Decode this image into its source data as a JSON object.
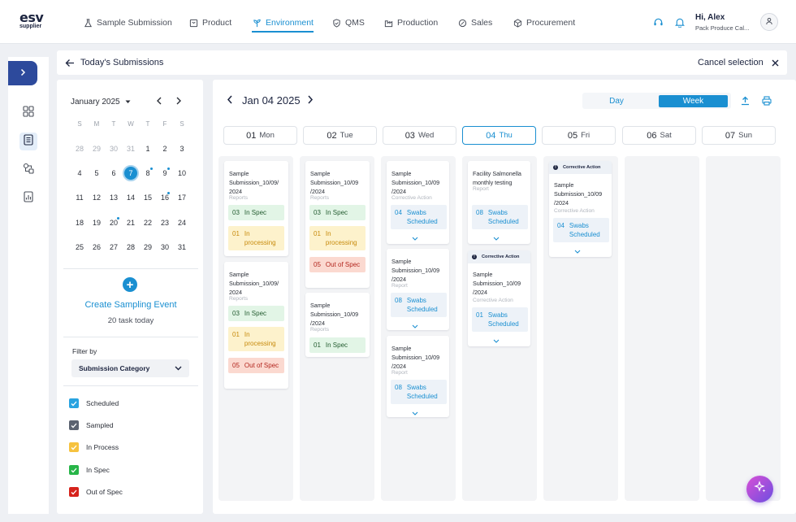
{
  "brand": {
    "logo_top": "esv",
    "logo_bottom": "supplier"
  },
  "nav": {
    "items": [
      {
        "label": "Sample Submission",
        "icon": "flask-icon"
      },
      {
        "label": "Product",
        "icon": "box-icon"
      },
      {
        "label": "Environment",
        "icon": "plant-icon",
        "active": true
      },
      {
        "label": "QMS",
        "icon": "shield-check-icon"
      },
      {
        "label": "Production",
        "icon": "factory-icon"
      },
      {
        "label": "Sales",
        "icon": "tag-icon"
      },
      {
        "label": "Procurement",
        "icon": "cube-icon"
      }
    ]
  },
  "user": {
    "greeting": "Hi, Alex",
    "org": "Pack Produce Cal..."
  },
  "title_bar": {
    "title": "Today's Submissions",
    "cancel_label": "Cancel selection"
  },
  "mini_calendar": {
    "month_label": "January 2025",
    "weekdays": [
      "S",
      "M",
      "T",
      "W",
      "T",
      "F",
      "S"
    ],
    "weeks": [
      [
        "28",
        "29",
        "30",
        "31",
        "1",
        "2",
        "3"
      ],
      [
        "4",
        "5",
        "6",
        "7",
        "8",
        "9",
        "10"
      ],
      [
        "11",
        "12",
        "13",
        "14",
        "15",
        "16",
        "17"
      ],
      [
        "18",
        "19",
        "20",
        "21",
        "22",
        "23",
        "24"
      ],
      [
        "25",
        "26",
        "27",
        "28",
        "29",
        "30",
        "31"
      ]
    ],
    "selected_day": "7"
  },
  "create_event": {
    "label": "Create Sampling Event",
    "tasks_today": "20 task today"
  },
  "filter": {
    "label": "Filter by",
    "selected": "Submission Category"
  },
  "legend": [
    {
      "label": "Scheduled",
      "color": "#29a3e0"
    },
    {
      "label": "Sampled",
      "color": "#5b6270"
    },
    {
      "label": "In Process",
      "color": "#f6c23e"
    },
    {
      "label": "In Spec",
      "color": "#27b548"
    },
    {
      "label": "Out of Spec",
      "color": "#d6231c"
    }
  ],
  "week_view": {
    "date_label": "Jan 04 2025",
    "view_day": "Day",
    "view_week": "Week",
    "days": [
      {
        "num": "01",
        "name": "Mon"
      },
      {
        "num": "02",
        "name": "Tue"
      },
      {
        "num": "03",
        "name": "Wed"
      },
      {
        "num": "04",
        "name": "Thu",
        "today": true
      },
      {
        "num": "05",
        "name": "Fri"
      },
      {
        "num": "06",
        "name": "Sat"
      },
      {
        "num": "07",
        "name": "Sun"
      }
    ]
  },
  "cards": {
    "mon1": {
      "title": "Sample Submission_10/09/ 2024",
      "sub": "Reports",
      "p1n": "03",
      "p1": "In Spec",
      "p2n": "01",
      "p2": "In processing"
    },
    "mon2": {
      "title": "Sample Submission_10/09/ 2024",
      "sub": "Reports",
      "p1n": "03",
      "p1": "In Spec",
      "p2n": "01",
      "p2": "In processing",
      "p3n": "05",
      "p3": "Out of Spec"
    },
    "tue1": {
      "title": "Sample Submission_10/09 /2024",
      "sub": "Reports",
      "p1n": "03",
      "p1": "In Spec",
      "p2n": "01",
      "p2": "In processing",
      "p3n": "05",
      "p3": "Out of Spec"
    },
    "tue2": {
      "title": "Sample Submission_10/09 /2024",
      "sub": "Reports",
      "p1n": "01",
      "p1": "In Spec"
    },
    "wed1": {
      "title": "Sample Submission_10/09 /2024",
      "sub": "Corrective Action",
      "p1n": "04",
      "p1": "Swabs Scheduled"
    },
    "wed2": {
      "title": "Sample Submission_10/09 /2024",
      "sub": "Report",
      "p1n": "08",
      "p1": "Swabs Scheduled"
    },
    "wed3": {
      "title": "Sample Submission_10/09 /2024",
      "sub": "Report",
      "p1n": "08",
      "p1": "Swabs Scheduled"
    },
    "thu1": {
      "title": "Facility Salmonella monthly testing",
      "sub": "Report",
      "p1n": "08",
      "p1": "Swabs Scheduled"
    },
    "thu2": {
      "badge": "Corrective Action",
      "title": "Sample Submission_10/09 /2024",
      "sub": "Corrective Action",
      "p1n": "01",
      "p1": "Swabs Scheduled"
    },
    "fri1": {
      "badge": "Corrective Action",
      "title": "Sample Submission_10/09 /2024",
      "sub": "Corrective Action",
      "p1n": "04",
      "p1": "Swabs Scheduled"
    }
  }
}
